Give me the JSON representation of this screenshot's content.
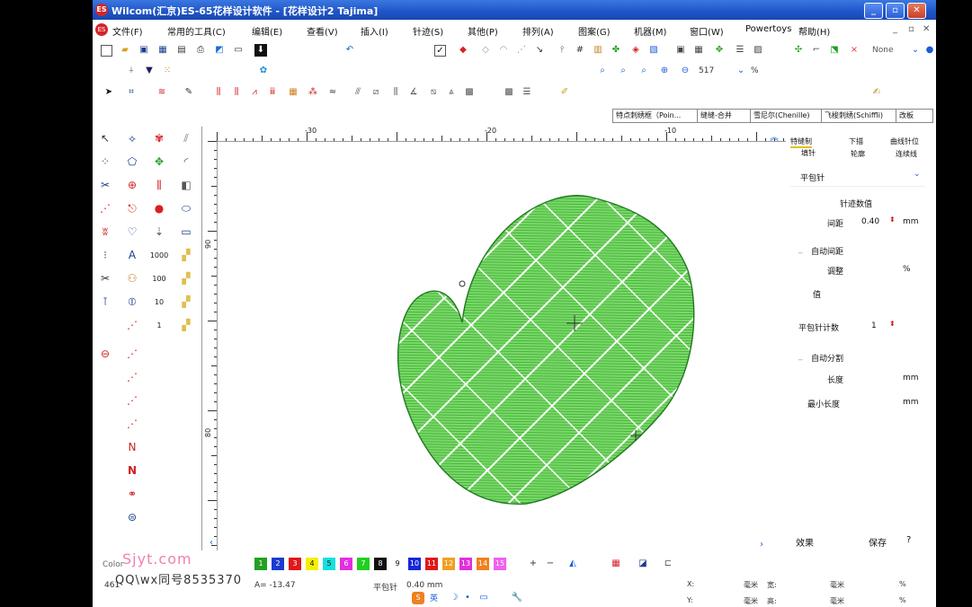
{
  "window": {
    "title": "Wilcom(汇京)ES-65花样设计软件 - [花样设计2      Tajima]",
    "app_icon_label": "ES",
    "controls": {
      "minimize": "_",
      "restore": "▫",
      "close": "✕"
    }
  },
  "menu": {
    "items": [
      "文件(F)",
      "常用的工具(C)",
      "编辑(E)",
      "查看(V)",
      "插入(I)",
      "针迹(S)",
      "其他(P)",
      "排列(A)",
      "图案(G)",
      "机器(M)",
      "窗口(W)",
      "Powertoys",
      "帮助(H)"
    ],
    "mdi_controls": [
      "_",
      "▫",
      "✕"
    ]
  },
  "toolbar": {
    "zoom_value": "517",
    "zoom_unit": "%",
    "none_label": "None"
  },
  "tabs": [
    "特点刺绣框（Poin...",
    "缝缝-合并",
    "雪尼尔(Chenille)",
    "飞梭刺绣(Schiffli)",
    "改板"
  ],
  "left_tools_numbers": [
    "1000",
    "100",
    "10",
    "1"
  ],
  "rulers": {
    "h_labels": [
      "-30",
      "-20",
      "-10"
    ],
    "v_labels": [
      "90",
      "80"
    ]
  },
  "panel": {
    "tabs_row1": [
      "特缝制",
      "下描",
      "曲线针位"
    ],
    "tabs_row2": [
      "填针",
      "轮廓",
      "连续线"
    ],
    "stitch_type": "平包针",
    "section_title": "针迹数值",
    "spacing_label": "间距",
    "spacing_value": "0.40",
    "spacing_unit": "mm",
    "auto_spacing_label": "自动间距",
    "adjust_label": "调整",
    "adjust_unit": "%",
    "value_label": "值",
    "satin_count_label": "平包针计数",
    "satin_count_value": "1",
    "auto_split_label": "自动分割",
    "length_label": "长度",
    "length_unit": "mm",
    "min_length_label": "最小长度",
    "min_length_unit": "mm",
    "effect_button": "效果",
    "save_button": "保存",
    "help_button": "?"
  },
  "colors": {
    "label": "Color",
    "swatches": [
      {
        "num": "1",
        "hex": "#22a022"
      },
      {
        "num": "2",
        "hex": "#1a3ccf"
      },
      {
        "num": "3",
        "hex": "#e01818"
      },
      {
        "num": "4",
        "hex": "#f4f000"
      },
      {
        "num": "5",
        "hex": "#14e0e0"
      },
      {
        "num": "6",
        "hex": "#e030e0"
      },
      {
        "num": "7",
        "hex": "#20d020"
      },
      {
        "num": "8",
        "hex": "#111111"
      },
      {
        "num": "9",
        "hex": "#ffffff"
      },
      {
        "num": "10",
        "hex": "#1428d8"
      },
      {
        "num": "11",
        "hex": "#e01818"
      },
      {
        "num": "12",
        "hex": "#f0a020"
      },
      {
        "num": "13",
        "hex": "#e030d8"
      },
      {
        "num": "14",
        "hex": "#f08020"
      },
      {
        "num": "15",
        "hex": "#f060f0"
      }
    ]
  },
  "status": {
    "count": "461",
    "angle": "A= -13.47",
    "stitch_name": "平包针",
    "stitch_spacing": "0.40 mm",
    "x_label": "X:",
    "y_label": "Y:",
    "mm1": "毫米",
    "width_label": "宽:",
    "height_label": "高:",
    "mm2": "毫米",
    "pct": "%"
  },
  "watermark": {
    "line1": "Sjyt.com",
    "line2": "QQ\\wx同号8535370"
  }
}
